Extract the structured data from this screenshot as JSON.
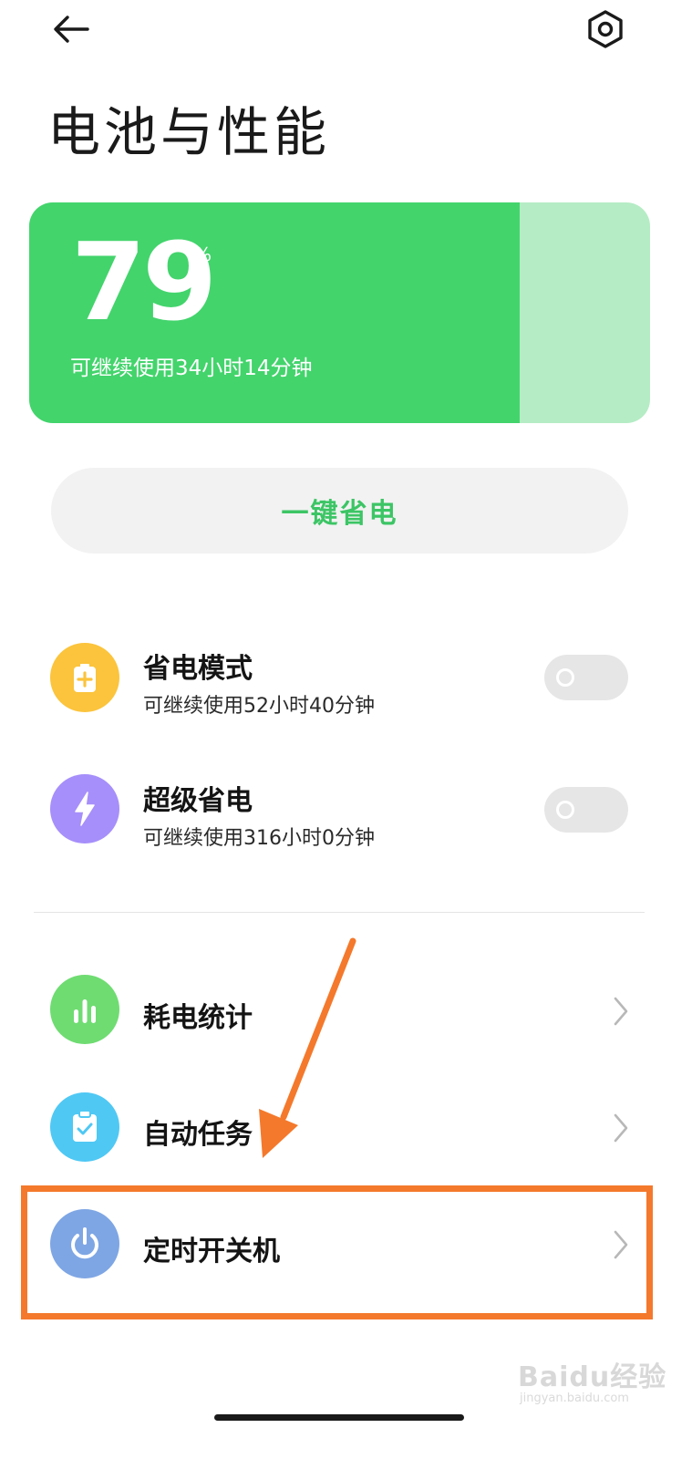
{
  "header": {
    "back_icon": "arrow-left-icon",
    "settings_icon": "gear-hex-icon",
    "title": "电池与性能"
  },
  "battery": {
    "percent": "79",
    "unit": "%",
    "level_fraction": 0.79,
    "remaining": "可继续使用34小时14分钟",
    "fill_color": "#43d46c",
    "track_color": "#b5ecc5"
  },
  "one_key_save": {
    "label": "一键省电",
    "color": "#3cc565"
  },
  "modes": [
    {
      "title": "省电模式",
      "subtitle": "可继续使用52小时40分钟",
      "icon": "battery-plus-icon",
      "icon_color": "#fbc43c",
      "enabled": false
    },
    {
      "title": "超级省电",
      "subtitle": "可继续使用316小时0分钟",
      "icon": "lightning-icon",
      "icon_color": "#a68ffa",
      "enabled": false
    }
  ],
  "links": [
    {
      "title": "耗电统计",
      "icon": "bar-chart-icon",
      "icon_color": "#6fdc72"
    },
    {
      "title": "自动任务",
      "icon": "clipboard-check-icon",
      "icon_color": "#4fc8f4"
    },
    {
      "title": "定时开关机",
      "icon": "power-icon",
      "icon_color": "#7ea6e4"
    }
  ],
  "annotation": {
    "color": "#f4792c",
    "arrow_icon": "annotation-arrow-icon"
  },
  "watermark": {
    "brand": "Baidu经验",
    "url": "jingyan.baidu.com"
  }
}
